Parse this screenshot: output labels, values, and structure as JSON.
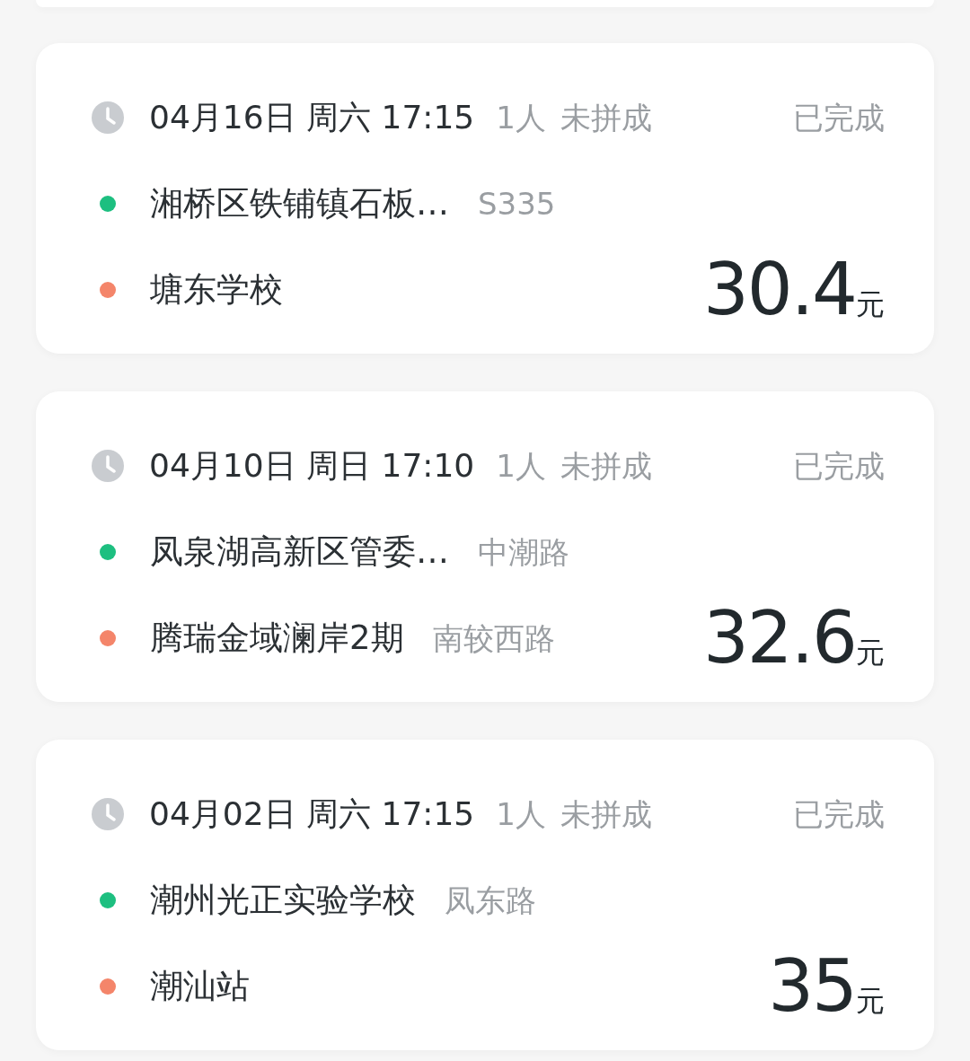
{
  "trips": [
    {
      "datetime": "04月16日 周六 17:15",
      "passengers": "1人",
      "pool_status": "未拼成",
      "status": "已完成",
      "stops": [
        {
          "name": "湘桥区铁铺镇石板…",
          "detail": "S335",
          "color": "#1dbf80"
        },
        {
          "name": "塘东学校",
          "color": "#f4856a"
        }
      ],
      "price": "30.4",
      "unit": "元"
    },
    {
      "datetime": "04月10日 周日 17:10",
      "passengers": "1人",
      "pool_status": "未拼成",
      "status": "已完成",
      "stops": [
        {
          "name": "凤泉湖高新区管委…",
          "detail": "中潮路",
          "color": "#1dbf80"
        },
        {
          "name": "腾瑞金域澜岸2期",
          "detail": "南较西路",
          "color": "#f4856a"
        }
      ],
      "price": "32.6",
      "unit": "元"
    },
    {
      "datetime": "04月02日 周六 17:15",
      "passengers": "1人",
      "pool_status": "未拼成",
      "status": "已完成",
      "stops": [
        {
          "name": "潮州光正实验学校",
          "detail": "凤东路",
          "color": "#1dbf80"
        },
        {
          "name": "潮汕站",
          "color": "#f4856a"
        }
      ],
      "price": "35",
      "unit": "元"
    }
  ]
}
